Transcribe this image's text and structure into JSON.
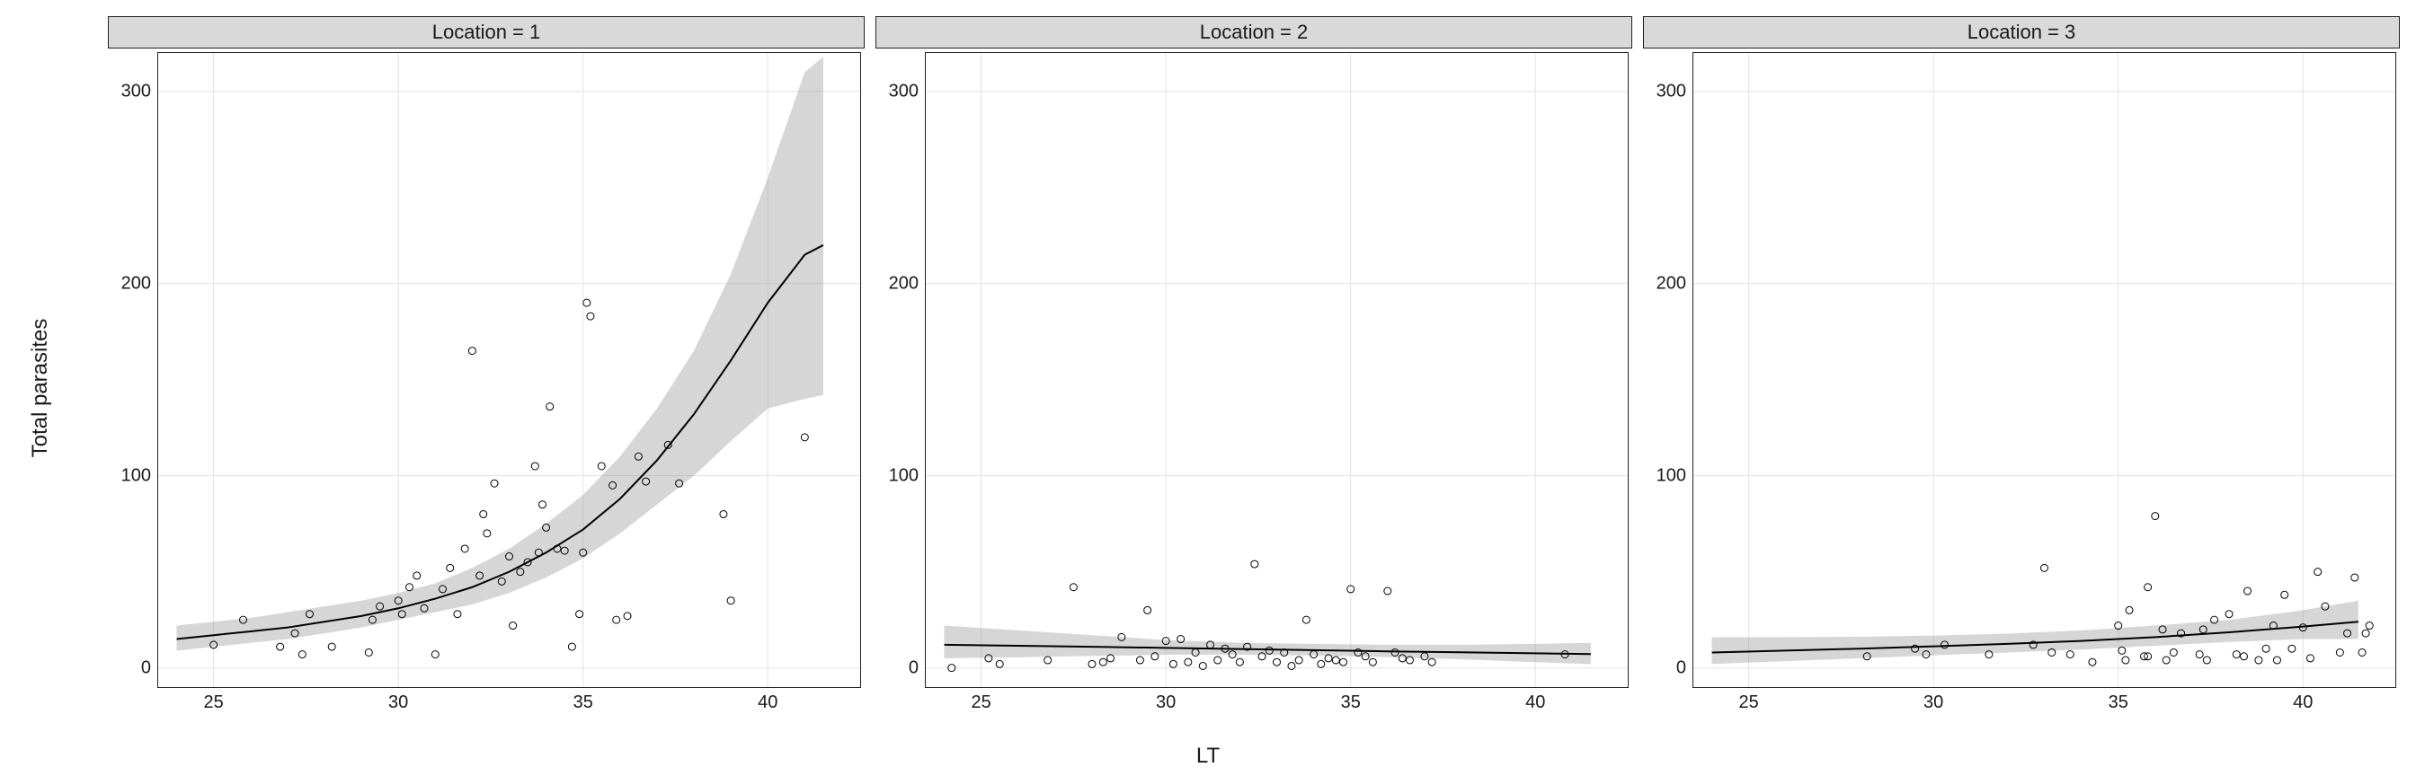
{
  "chart_data": [
    {
      "type": "scatter",
      "facet_label": "Location = 1",
      "xlabel": "LT",
      "ylabel": "Total parasites",
      "xlim": [
        23.5,
        42.5
      ],
      "ylim": [
        -10,
        320
      ],
      "xticks": [
        25,
        30,
        35,
        40
      ],
      "yticks": [
        0,
        100,
        200,
        300
      ],
      "points": [
        [
          25.0,
          12
        ],
        [
          25.8,
          25
        ],
        [
          26.8,
          11
        ],
        [
          27.2,
          18
        ],
        [
          27.4,
          7
        ],
        [
          27.6,
          28
        ],
        [
          28.2,
          11
        ],
        [
          29.2,
          8
        ],
        [
          29.3,
          25
        ],
        [
          29.5,
          32
        ],
        [
          30.0,
          35
        ],
        [
          30.1,
          28
        ],
        [
          30.3,
          42
        ],
        [
          30.5,
          48
        ],
        [
          30.7,
          31
        ],
        [
          31.0,
          7
        ],
        [
          31.2,
          41
        ],
        [
          31.4,
          52
        ],
        [
          31.6,
          28
        ],
        [
          31.8,
          62
        ],
        [
          32.0,
          165
        ],
        [
          32.2,
          48
        ],
        [
          32.3,
          80
        ],
        [
          32.4,
          70
        ],
        [
          32.6,
          96
        ],
        [
          32.8,
          45
        ],
        [
          33.0,
          58
        ],
        [
          33.1,
          22
        ],
        [
          33.3,
          50
        ],
        [
          33.5,
          55
        ],
        [
          33.8,
          60
        ],
        [
          33.7,
          105
        ],
        [
          33.9,
          85
        ],
        [
          34.0,
          73
        ],
        [
          34.1,
          136
        ],
        [
          34.3,
          62
        ],
        [
          34.5,
          61
        ],
        [
          34.7,
          11
        ],
        [
          34.9,
          28
        ],
        [
          35.0,
          60
        ],
        [
          35.1,
          190
        ],
        [
          35.2,
          183
        ],
        [
          35.5,
          105
        ],
        [
          35.8,
          95
        ],
        [
          35.9,
          25
        ],
        [
          36.2,
          27
        ],
        [
          36.5,
          110
        ],
        [
          36.7,
          97
        ],
        [
          37.3,
          116
        ],
        [
          37.6,
          96
        ],
        [
          38.8,
          80
        ],
        [
          39.0,
          35
        ],
        [
          41.0,
          120
        ]
      ],
      "fit_x": [
        24,
        25,
        26,
        27,
        28,
        29,
        30,
        31,
        32,
        33,
        34,
        35,
        36,
        37,
        38,
        39,
        40,
        41,
        41.5
      ],
      "fit_y": [
        15,
        17,
        19,
        21,
        24,
        27,
        31,
        36,
        42,
        50,
        60,
        72,
        88,
        108,
        132,
        160,
        190,
        215,
        220
      ],
      "fit_lower": [
        9,
        11,
        13,
        15,
        18,
        21,
        25,
        29,
        33,
        39,
        47,
        57,
        70,
        85,
        100,
        118,
        135,
        140,
        142
      ],
      "fit_upper": [
        22,
        24,
        26,
        29,
        32,
        35,
        39,
        44,
        52,
        62,
        75,
        90,
        110,
        135,
        165,
        205,
        255,
        310,
        318
      ]
    },
    {
      "type": "scatter",
      "facet_label": "Location = 2",
      "xlabel": "LT",
      "ylabel": "Total parasites",
      "xlim": [
        23.5,
        42.5
      ],
      "ylim": [
        -10,
        320
      ],
      "xticks": [
        25,
        30,
        35,
        40
      ],
      "yticks": [
        0,
        100,
        200,
        300
      ],
      "points": [
        [
          24.2,
          0
        ],
        [
          25.2,
          5
        ],
        [
          25.5,
          2
        ],
        [
          26.8,
          4
        ],
        [
          27.5,
          42
        ],
        [
          28.0,
          2
        ],
        [
          28.3,
          3
        ],
        [
          28.5,
          5
        ],
        [
          28.8,
          16
        ],
        [
          29.3,
          4
        ],
        [
          29.5,
          30
        ],
        [
          29.7,
          6
        ],
        [
          30.0,
          14
        ],
        [
          30.2,
          2
        ],
        [
          30.4,
          15
        ],
        [
          30.6,
          3
        ],
        [
          30.8,
          8
        ],
        [
          31.0,
          1
        ],
        [
          31.2,
          12
        ],
        [
          31.4,
          4
        ],
        [
          31.6,
          10
        ],
        [
          31.8,
          7
        ],
        [
          32.0,
          3
        ],
        [
          32.2,
          11
        ],
        [
          32.4,
          54
        ],
        [
          32.6,
          6
        ],
        [
          32.8,
          9
        ],
        [
          33.0,
          3
        ],
        [
          33.2,
          8
        ],
        [
          33.4,
          1
        ],
        [
          33.6,
          4
        ],
        [
          33.8,
          25
        ],
        [
          34.0,
          7
        ],
        [
          34.2,
          2
        ],
        [
          34.4,
          5
        ],
        [
          34.6,
          4
        ],
        [
          34.8,
          3
        ],
        [
          35.0,
          41
        ],
        [
          35.2,
          8
        ],
        [
          35.4,
          6
        ],
        [
          35.6,
          3
        ],
        [
          36.0,
          40
        ],
        [
          36.2,
          8
        ],
        [
          36.4,
          5
        ],
        [
          36.6,
          4
        ],
        [
          37.0,
          6
        ],
        [
          37.2,
          3
        ],
        [
          40.8,
          7
        ]
      ],
      "fit_x": [
        24,
        26,
        28,
        30,
        32,
        34,
        36,
        38,
        40,
        41.5
      ],
      "fit_y": [
        12,
        11.5,
        11,
        10.4,
        9.8,
        9.2,
        8.6,
        8.1,
        7.6,
        7.2
      ],
      "fit_lower": [
        5,
        5.5,
        6.2,
        6.8,
        6.9,
        6.4,
        5.6,
        4.5,
        3.0,
        2.0
      ],
      "fit_upper": [
        22,
        19.5,
        17,
        14.5,
        13,
        12.5,
        12,
        12,
        12.5,
        13
      ]
    },
    {
      "type": "scatter",
      "facet_label": "Location = 3",
      "xlabel": "LT",
      "ylabel": "Total parasites",
      "xlim": [
        23.5,
        42.5
      ],
      "ylim": [
        -10,
        320
      ],
      "xticks": [
        25,
        30,
        35,
        40
      ],
      "yticks": [
        0,
        100,
        200,
        300
      ],
      "points": [
        [
          28.2,
          6
        ],
        [
          29.5,
          10
        ],
        [
          29.8,
          7
        ],
        [
          30.3,
          12
        ],
        [
          31.5,
          7
        ],
        [
          32.7,
          12
        ],
        [
          33.0,
          52
        ],
        [
          33.2,
          8
        ],
        [
          33.7,
          7
        ],
        [
          34.3,
          3
        ],
        [
          35.0,
          22
        ],
        [
          35.1,
          9
        ],
        [
          35.2,
          4
        ],
        [
          35.3,
          30
        ],
        [
          35.7,
          6
        ],
        [
          35.8,
          6
        ],
        [
          35.8,
          42
        ],
        [
          36.0,
          79
        ],
        [
          36.2,
          20
        ],
        [
          36.3,
          4
        ],
        [
          36.5,
          8
        ],
        [
          36.7,
          18
        ],
        [
          37.2,
          7
        ],
        [
          37.3,
          20
        ],
        [
          37.4,
          4
        ],
        [
          37.6,
          25
        ],
        [
          38.0,
          28
        ],
        [
          38.2,
          7
        ],
        [
          38.4,
          6
        ],
        [
          38.5,
          40
        ],
        [
          38.8,
          4
        ],
        [
          39.0,
          10
        ],
        [
          39.2,
          22
        ],
        [
          39.3,
          4
        ],
        [
          39.5,
          38
        ],
        [
          39.7,
          10
        ],
        [
          40.0,
          21
        ],
        [
          40.2,
          5
        ],
        [
          40.4,
          50
        ],
        [
          40.6,
          32
        ],
        [
          41.0,
          8
        ],
        [
          41.2,
          18
        ],
        [
          41.4,
          47
        ],
        [
          41.6,
          8
        ],
        [
          41.7,
          18
        ],
        [
          41.8,
          22
        ]
      ],
      "fit_x": [
        24,
        26,
        28,
        30,
        32,
        34,
        36,
        38,
        40,
        41.5
      ],
      "fit_y": [
        8,
        9,
        10,
        11.2,
        12.5,
        14,
        16,
        18.5,
        21.5,
        24
      ],
      "fit_lower": [
        2,
        3.5,
        5,
        6.5,
        8,
        9.5,
        11.5,
        13.5,
        15,
        15
      ],
      "fit_upper": [
        16,
        16,
        16.2,
        16.8,
        17.8,
        19.5,
        22,
        25,
        30,
        35
      ]
    }
  ],
  "axis": {
    "xlabel": "LT",
    "ylabel": "Total parasites"
  }
}
